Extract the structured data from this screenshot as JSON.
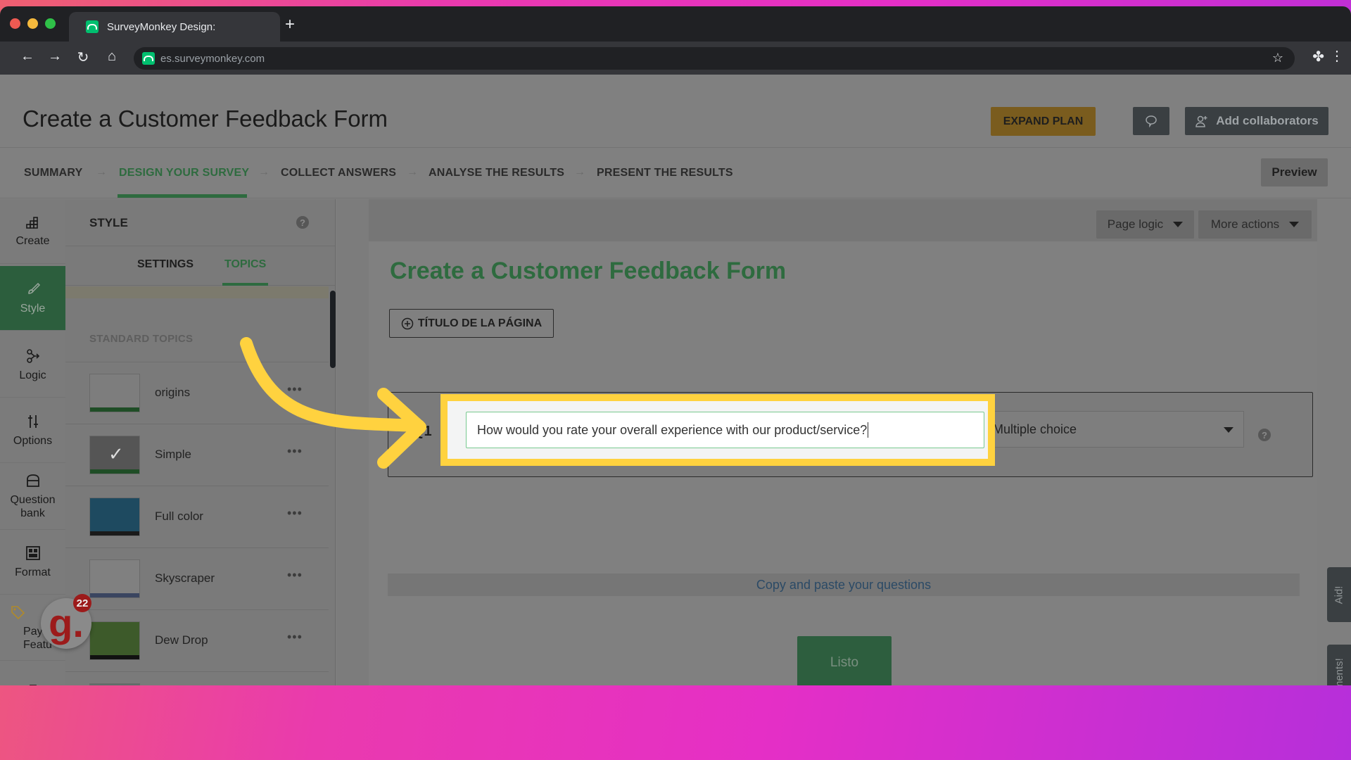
{
  "browser": {
    "tab_title": "SurveyMonkey Design:",
    "url": "es.surveymonkey.com",
    "new_tab_label": "+"
  },
  "header": {
    "title": "Create a Customer Feedback Form",
    "expand_plan": "EXPAND PLAN",
    "add_collaborators": "Add collaborators",
    "preview": "Preview"
  },
  "steps": [
    {
      "label": "SUMMARY",
      "active": false
    },
    {
      "label": "DESIGN YOUR SURVEY",
      "active": true
    },
    {
      "label": "COLLECT ANSWERS",
      "active": false
    },
    {
      "label": "ANALYSE THE RESULTS",
      "active": false
    },
    {
      "label": "PRESENT THE RESULTS",
      "active": false
    }
  ],
  "rail": [
    {
      "label": "Create",
      "icon": "chart-grid-icon"
    },
    {
      "label": "Style",
      "icon": "paintbrush-icon",
      "active": true
    },
    {
      "label": "Logic",
      "icon": "logic-branch-icon"
    },
    {
      "label": "Options",
      "icon": "sliders-icon"
    },
    {
      "label": "Question bank",
      "icon": "question-bank-icon"
    },
    {
      "label": "Format",
      "icon": "format-layout-icon"
    },
    {
      "label": "Payment Features",
      "icon": "price-tag-icon",
      "visible_text": "Paym Featu"
    }
  ],
  "panel": {
    "title": "STYLE",
    "tabs": [
      "SETTINGS",
      "TOPICS"
    ],
    "active_tab": "TOPICS",
    "section_label": "STANDARD TOPICS",
    "topics": [
      {
        "name": "origins",
        "thumb_color": "#7d7d7d",
        "bar_color": "#1f4d26"
      },
      {
        "name": "Simple",
        "thumb_color": "#555555",
        "bar_color": "#1f4d26",
        "selected": true
      },
      {
        "name": "Full color",
        "thumb_color": "#1e4a60",
        "bar_color": "#1a1a1a"
      },
      {
        "name": "Skyscraper",
        "thumb_color": "#808080",
        "bar_color": "#3a4560"
      },
      {
        "name": "Dew Drop",
        "thumb_color": "#3d5a2a",
        "bar_color": "#111111"
      }
    ],
    "more_label": "•••"
  },
  "canvas": {
    "page_logic": "Page logic",
    "more_actions": "More actions",
    "survey_title": "Create a Customer Feedback Form",
    "add_page_title": "TÍTULO DE LA PÁGINA",
    "question_number": "Q1",
    "question_text": "How would you rate your overall experience with our product/service?",
    "question_type": "Multiple choice",
    "copy_paste": "Copy and paste your questions",
    "done": "Listo"
  },
  "side_tabs": {
    "help": "Aid!",
    "comments": "Comments!"
  },
  "notification": {
    "letter": "g.",
    "count": "22"
  },
  "colors": {
    "brand_green": "#2e6b3f",
    "highlight_yellow": "#ffd23f",
    "expand_plan_gold": "#7a5c1e"
  }
}
